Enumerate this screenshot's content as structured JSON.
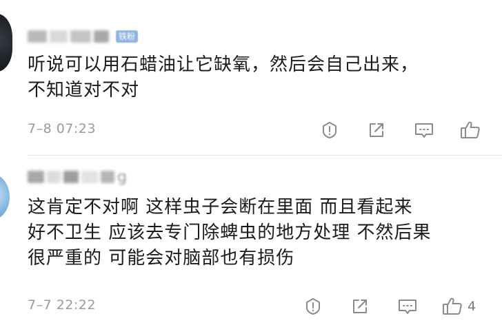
{
  "comments": [
    {
      "username": "",
      "badge": "铁粉",
      "lines": [
        "听说可以用石蜡油让它缺氧，然后会自己出来，",
        "不知道对不对"
      ],
      "timestamp": "7–8 07:23",
      "likes": ""
    },
    {
      "username": "g",
      "badge": "",
      "lines": [
        "这肯定不对啊  这样虫子会断在里面  而且看起来",
        "好不卫生  应该去专门除蜱虫的地方处理  不然后果",
        "很严重的  可能会对脑部也有损伤"
      ],
      "timestamp": "7–7 22:22",
      "likes": "4"
    }
  ],
  "icons": {
    "report": "warning-icon",
    "share": "share-icon",
    "reply": "comment-icon",
    "like": "thumbs-up-icon"
  },
  "colors": {
    "text": "#1a1a1a",
    "meta": "#9a9a9a",
    "icon": "#8a8a8a",
    "divider": "#e6e6e6",
    "badge": "#8fb4e0"
  }
}
